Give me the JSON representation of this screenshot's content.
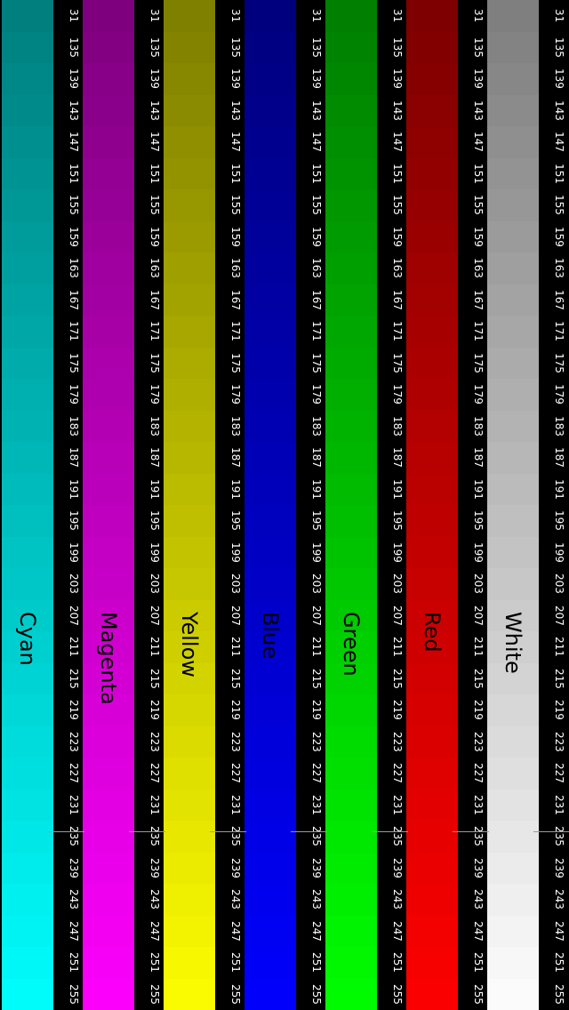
{
  "bars": [
    {
      "name": "white",
      "label": "White",
      "color": "#ffffff"
    },
    {
      "name": "red",
      "label": "Red",
      "color": "#ff0000"
    },
    {
      "name": "green",
      "label": "Green",
      "color": "#00ff00"
    },
    {
      "name": "blue",
      "label": "Blue",
      "color": "#0000ff"
    },
    {
      "name": "yellow",
      "label": "Yellow",
      "color": "#ffff00"
    },
    {
      "name": "magenta",
      "label": "Magenta",
      "color": "#ff00ff"
    },
    {
      "name": "cyan",
      "label": "Cyan",
      "color": "#00ffff"
    }
  ],
  "scale_values": [
    "31",
    "135",
    "139",
    "143",
    "147",
    "151",
    "155",
    "159",
    "163",
    "167",
    "171",
    "175",
    "179",
    "183",
    "187",
    "191",
    "195",
    "199",
    "203",
    "207",
    "211",
    "215",
    "219",
    "223",
    "227",
    "231",
    "235",
    "239",
    "243",
    "247",
    "251",
    "255"
  ],
  "colors": {
    "background": "#000000",
    "tick_text": "#ffffff",
    "label_text": "#000000"
  }
}
